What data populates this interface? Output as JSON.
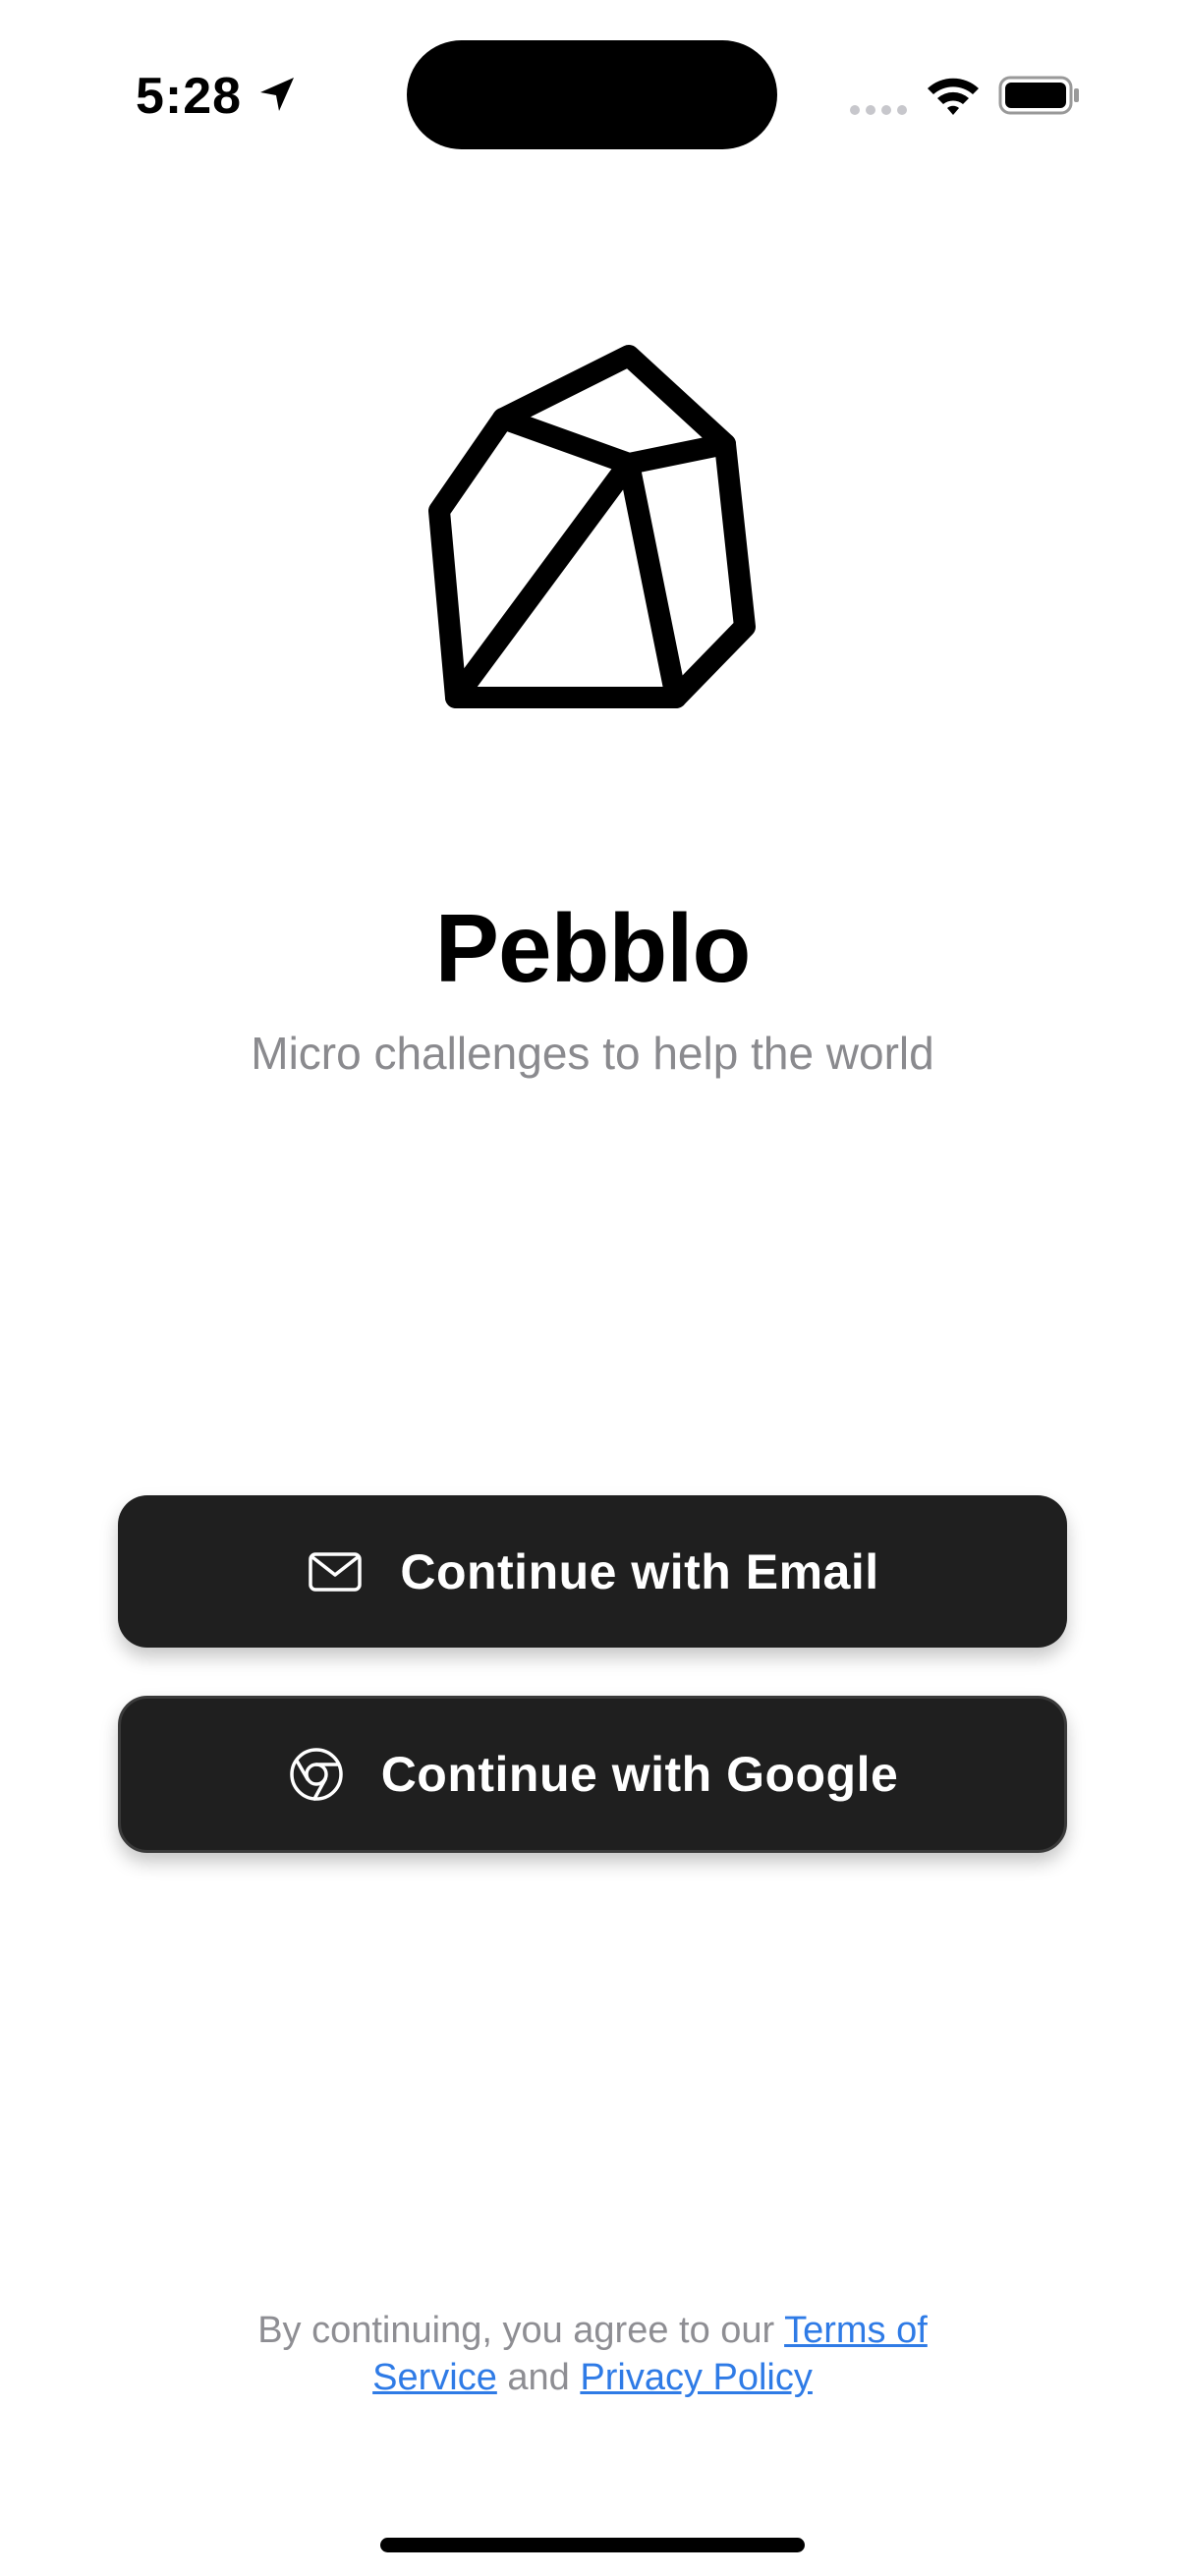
{
  "status_bar": {
    "time": "5:28",
    "icons": [
      "location-arrow-icon",
      "cellular-signal-icon",
      "wifi-icon",
      "battery-icon"
    ]
  },
  "app": {
    "logo_icon": "pebble-logo-icon",
    "title": "Pebblo",
    "subtitle": "Micro challenges to help the world"
  },
  "auth": {
    "email_button_label": "Continue with Email",
    "email_icon": "mail-icon",
    "google_button_label": "Continue with Google",
    "google_icon": "chrome-icon"
  },
  "legal": {
    "prefix": "By continuing, you agree to our ",
    "terms_link": "Terms of Service",
    "joiner": " and ",
    "privacy_link": "Privacy Policy"
  },
  "colors": {
    "button_bg": "#1f1f1f",
    "link": "#2f7be6",
    "secondary_text": "#8a8a8e"
  }
}
